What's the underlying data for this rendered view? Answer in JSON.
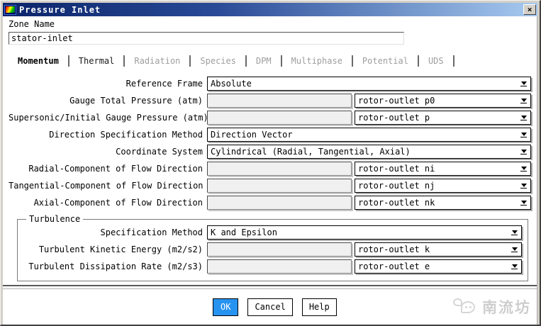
{
  "window": {
    "title": "Pressure Inlet",
    "close": "×"
  },
  "zone": {
    "label": "Zone Name",
    "value": "stator-inlet"
  },
  "tabs": [
    {
      "label": "Momentum",
      "state": "active"
    },
    {
      "label": "Thermal",
      "state": "enabled"
    },
    {
      "label": "Radiation",
      "state": "disabled"
    },
    {
      "label": "Species",
      "state": "disabled"
    },
    {
      "label": "DPM",
      "state": "disabled"
    },
    {
      "label": "Multiphase",
      "state": "disabled"
    },
    {
      "label": "Potential",
      "state": "disabled"
    },
    {
      "label": "UDS",
      "state": "disabled"
    }
  ],
  "form": {
    "rows": [
      {
        "label": "Reference Frame",
        "type": "select",
        "select_value": "Absolute"
      },
      {
        "label": "Gauge Total Pressure (atm)",
        "type": "input-select",
        "input_value": "",
        "select_value": "rotor-outlet p0"
      },
      {
        "label": "Supersonic/Initial Gauge Pressure (atm)",
        "type": "input-select",
        "input_value": "",
        "select_value": "rotor-outlet p"
      },
      {
        "label": "Direction Specification Method",
        "type": "select",
        "select_value": "Direction Vector"
      },
      {
        "label": "Coordinate System",
        "type": "select",
        "select_value": "Cylindrical (Radial, Tangential, Axial)"
      },
      {
        "label": "Radial-Component of Flow Direction",
        "type": "input-select",
        "input_value": "",
        "select_value": "rotor-outlet ni"
      },
      {
        "label": "Tangential-Component of Flow Direction",
        "type": "input-select",
        "input_value": "",
        "select_value": "rotor-outlet nj"
      },
      {
        "label": "Axial-Component of Flow Direction",
        "type": "input-select",
        "input_value": "",
        "select_value": "rotor-outlet nk"
      }
    ]
  },
  "turbulence": {
    "title": "Turbulence",
    "rows": [
      {
        "label": "Specification Method",
        "type": "select",
        "select_value": "K and Epsilon"
      },
      {
        "label": "Turbulent Kinetic Energy (m2/s2)",
        "type": "input-select",
        "input_value": "",
        "select_value": "rotor-outlet k"
      },
      {
        "label": "Turbulent Dissipation Rate (m2/s3)",
        "type": "input-select",
        "input_value": "",
        "select_value": "rotor-outlet e"
      }
    ]
  },
  "footer": {
    "ok": "OK",
    "cancel": "Cancel",
    "help": "Help"
  },
  "watermark": {
    "text": "南流坊"
  },
  "colors": {
    "title_gradient_start": "#0a246a",
    "title_gradient_end": "#a6caf0",
    "ok_button": "#2793f0",
    "disabled_tab": "#9e9e9e",
    "entry_fill": "#f0f0f0",
    "watermark": "#cfcfcf"
  }
}
